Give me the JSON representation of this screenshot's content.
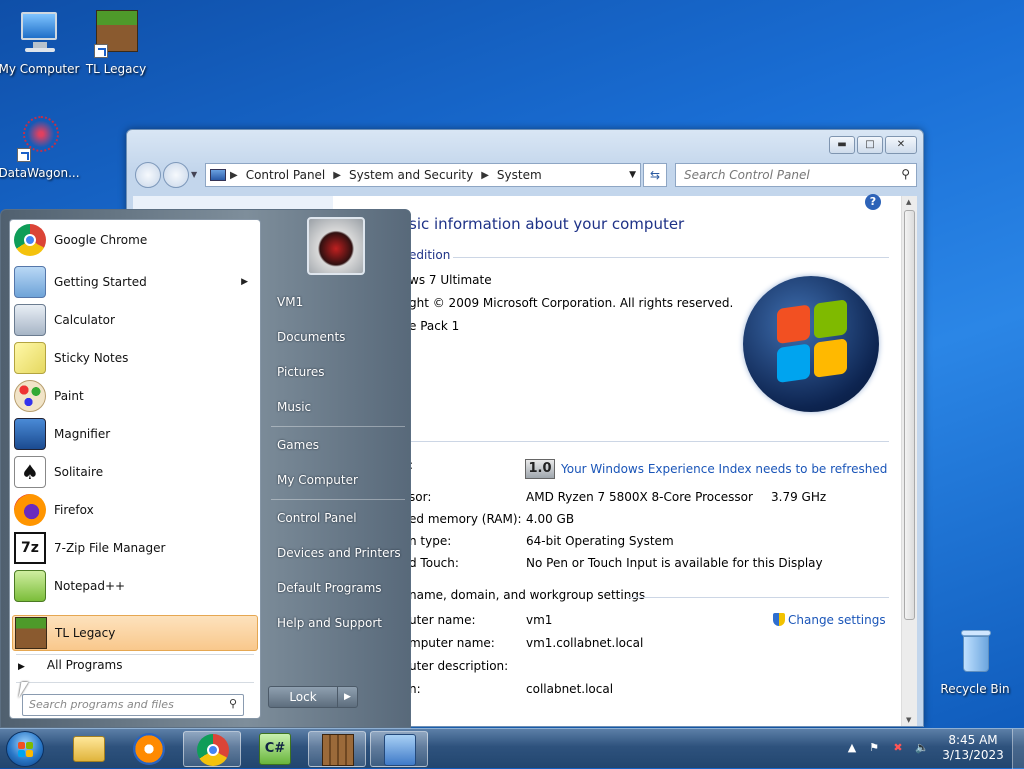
{
  "desktop": {
    "icons": [
      {
        "label": "My Computer",
        "icon": "computer-icon"
      },
      {
        "label": "TL Legacy",
        "icon": "minecraft-block-icon"
      },
      {
        "label": "DataWagon...",
        "icon": "datawagon-icon"
      },
      {
        "label": "Recycle Bin",
        "icon": "recycle-bin-icon"
      }
    ]
  },
  "window": {
    "breadcrumb": [
      "Control Panel",
      "System and Security",
      "System"
    ],
    "search_placeholder": "Search Control Panel",
    "heading": "sic information about your computer",
    "edition_title": "edition",
    "edition_name": "ws 7 Ultimate",
    "copyright": "ght © 2009 Microsoft Corporation.  All rights reserved.",
    "service_pack": "e Pack 1",
    "system_title": ":",
    "wei_score": "1.0",
    "wei_link": "Your Windows Experience Index needs to be refreshed",
    "processor_label": "sor:",
    "processor_value": "AMD Ryzen 7 5800X 8-Core Processor",
    "processor_speed": "3.79 GHz",
    "ram_label": "ed memory (RAM):",
    "ram_value": "4.00 GB",
    "systype_label": "n type:",
    "systype_value": "64-bit Operating System",
    "pen_label": "d Touch:",
    "pen_value": "No Pen or Touch Input is available for this Display",
    "name_section": " name, domain, and workgroup settings",
    "computer_name_label": "uter name:",
    "computer_name_value": "vm1",
    "change_settings": "Change settings",
    "full_name_label": "mputer name:",
    "full_name_value": "vm1.collabnet.local",
    "description_label": "uter description:",
    "domain_label": "n:",
    "domain_value": "collabnet.local"
  },
  "start_menu": {
    "programs": [
      {
        "label": "Google Chrome",
        "icon": "chrome-icon"
      },
      {
        "label": "Getting Started",
        "icon": "getting-started-icon",
        "submenu": true
      },
      {
        "label": "Calculator",
        "icon": "calculator-icon"
      },
      {
        "label": "Sticky Notes",
        "icon": "sticky-notes-icon"
      },
      {
        "label": "Paint",
        "icon": "paint-icon"
      },
      {
        "label": "Magnifier",
        "icon": "magnifier-icon"
      },
      {
        "label": "Solitaire",
        "icon": "solitaire-icon"
      },
      {
        "label": "Firefox",
        "icon": "firefox-icon"
      },
      {
        "label": "7-Zip File Manager",
        "icon": "seven-zip-icon"
      },
      {
        "label": "Notepad++",
        "icon": "notepadpp-icon"
      },
      {
        "label": "TL Legacy",
        "icon": "minecraft-block-icon",
        "selected": true
      }
    ],
    "all_programs": "All Programs",
    "search_placeholder": "Search programs and files",
    "right_items": [
      "VM1",
      "Documents",
      "Pictures",
      "Music",
      "Games",
      "My Computer",
      "Control Panel",
      "Devices and Printers",
      "Default Programs",
      "Help and Support"
    ],
    "lock_label": "Lock"
  },
  "taskbar": {
    "time": "8:45 AM",
    "date": "3/13/2023"
  },
  "colors": {
    "accent": "#1e3287",
    "link": "#1a55b8",
    "selected_bg": "#f9c88c"
  }
}
